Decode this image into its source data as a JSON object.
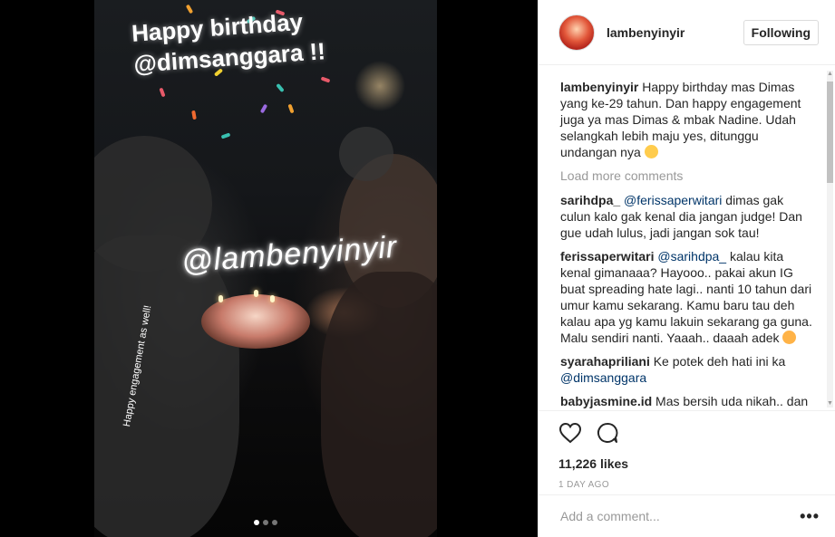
{
  "post": {
    "story_title_line1": "Happy birthday",
    "story_title_line2": "@dimsanggara !!",
    "story_mention": "@lambenyinyir",
    "side_caption": "Happy engagement as well!",
    "carousel_count": 3,
    "carousel_active": 1
  },
  "header": {
    "username": "lambenyinyir",
    "follow_label": "Following"
  },
  "caption": {
    "username": "lambenyinyir",
    "text": "Happy birthday mas Dimas yang ke-29 tahun. Dan happy engagement juga ya mas Dimas & mbak Nadine. Udah selangkah lebih maju yes, ditunggu undangan nya"
  },
  "load_more": "Load more comments",
  "comments": [
    {
      "username": "sarihdpa_",
      "mention": "@ferissaperwitari",
      "text": " dimas gak culun kalo gak kenal dia jangan judge! Dan gue udah lulus, jadi jangan sok tau!"
    },
    {
      "username": "ferissaperwitari",
      "mention": "@sarihdpa_",
      "text": " kalau kita kenal gimanaaa? Hayooo.. pakai akun IG buat spreading hate lagi.. nanti 10 tahun dari umur kamu sekarang. Kamu baru tau deh kalau apa yg kamu lakuin sekarang ga guna. Malu sendiri nanti. Yaaah.. daaah adek"
    },
    {
      "username": "syarahapriliani",
      "text": "Ke potek deh hati ini ka",
      "mention_after": "@dimsanggara"
    },
    {
      "username": "babyjasmine.id",
      "text": "Mas bersih uda nikah.. dan"
    }
  ],
  "likes": "11,226 likes",
  "time": "1 DAY AGO",
  "add_comment_placeholder": "Add a comment...",
  "icons": [
    "heart-icon",
    "comment-icon",
    "more-options-icon"
  ],
  "colors": {
    "mention": "#003569",
    "muted": "#999999",
    "text": "#262626"
  }
}
